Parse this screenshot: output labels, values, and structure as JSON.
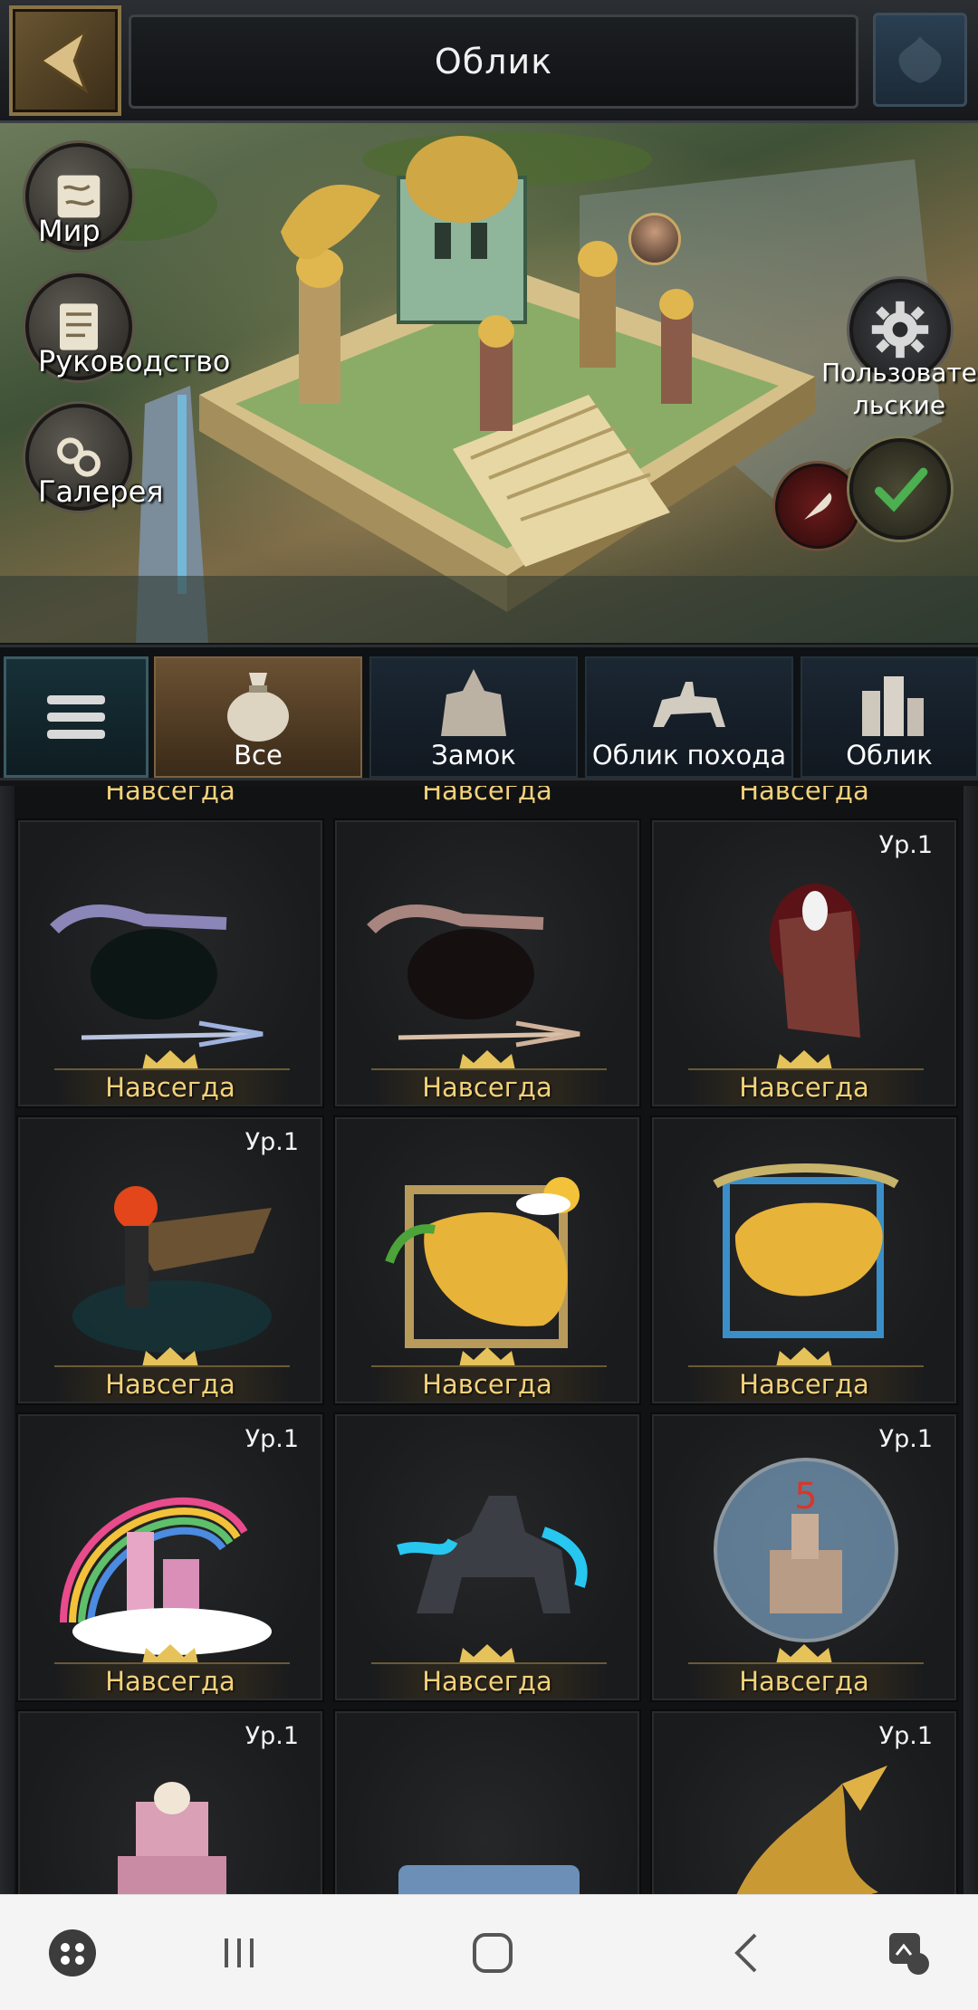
{
  "header": {
    "title": "Облик",
    "back_icon": "chevron-left-icon"
  },
  "preview": {
    "side_buttons": [
      {
        "label": "Мир",
        "icon": "map-scroll-icon"
      },
      {
        "label": "Руководство",
        "icon": "guide-scroll-icon"
      },
      {
        "label": "Галерея",
        "icon": "gallery-chain-icon"
      }
    ],
    "settings_label": "Пользовательские",
    "settings_label_line1": "Пользовате",
    "settings_label_line2": "льские"
  },
  "tabs": [
    {
      "label": "Все",
      "icon": "bag-icon",
      "active": true
    },
    {
      "label": "Замок",
      "icon": "castle-icon",
      "active": false
    },
    {
      "label": "Облик похода",
      "icon": "cavalry-icon",
      "active": false
    },
    {
      "label": "Облик",
      "icon": "city-icon",
      "active": false
    }
  ],
  "grid": {
    "top_row_partial": [
      "Навсегда",
      "Навсегда",
      "Навсегда"
    ],
    "items": [
      {
        "duration": "Навсегда",
        "level": "",
        "art": "arrow-frame-violet"
      },
      {
        "duration": "Навсегда",
        "level": "",
        "art": "arrow-frame-rose"
      },
      {
        "duration": "Навсегда",
        "level": "Ур.1",
        "art": "eagle-banner"
      },
      {
        "duration": "Навсегда",
        "level": "Ур.1",
        "art": "fire-dragon-knight"
      },
      {
        "duration": "Навсегда",
        "level": "",
        "art": "tropical-avatar-frame"
      },
      {
        "duration": "Навсегда",
        "level": "",
        "art": "laurel-avatar-frame"
      },
      {
        "duration": "Навсегда",
        "level": "Ур.1",
        "art": "rainbow-castle"
      },
      {
        "duration": "Навсегда",
        "level": "",
        "art": "ice-armored-horse"
      },
      {
        "duration": "Навсегда",
        "level": "Ур.1",
        "art": "snow-globe-castle"
      },
      {
        "duration": "",
        "level": "Ур.1",
        "art": "cake-castle"
      },
      {
        "duration": "",
        "level": "",
        "art": "happy-birthday-banner"
      },
      {
        "duration": "",
        "level": "Ур.1",
        "art": "golden-dragon"
      }
    ]
  },
  "colors": {
    "gold_text": "#f3d27a",
    "active_tab": "#6b5133",
    "tab_bg": "#1b2733",
    "background": "#141416"
  },
  "navbar": {
    "icons": [
      "game-launcher-icon",
      "recent-apps-icon",
      "home-icon",
      "back-icon",
      "screenshot-edit-icon"
    ]
  }
}
